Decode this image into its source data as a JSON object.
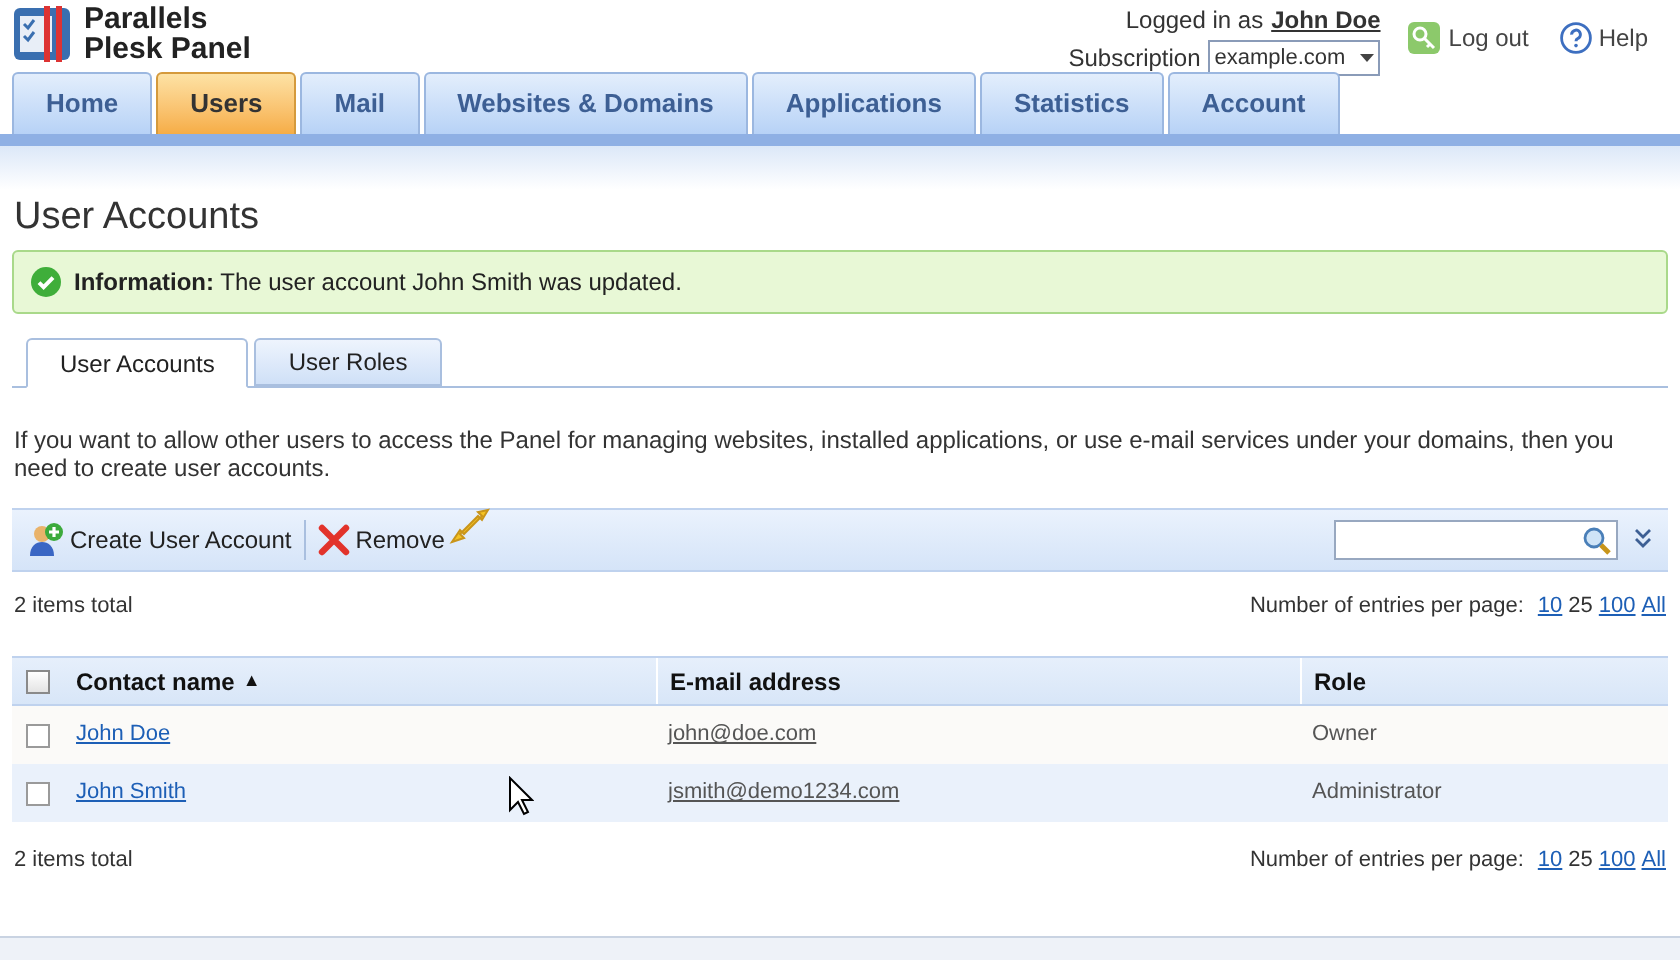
{
  "brand": {
    "line_1": "Parallels",
    "line_2": "Plesk Panel"
  },
  "header": {
    "logged_in_label": "Logged in as",
    "user": "John Doe",
    "subscription_label": "Subscription",
    "subscription": "example.com",
    "logout": "Log out",
    "help": "Help"
  },
  "nav_tabs": [
    {
      "label": "Home",
      "selected": false
    },
    {
      "label": "Users",
      "selected": true
    },
    {
      "label": "Mail",
      "selected": false
    },
    {
      "label": "Websites & Domains",
      "selected": false
    },
    {
      "label": "Applications",
      "selected": false
    },
    {
      "label": "Statistics",
      "selected": false
    },
    {
      "label": "Account",
      "selected": false
    }
  ],
  "page_title": "User Accounts",
  "message": {
    "text": "**Information:** The user account John Smith was updated."
  },
  "sub_tabs": [
    {
      "label": "User Accounts",
      "selected": true
    },
    {
      "label": "User Roles",
      "selected": false
    }
  ],
  "description": "If you want to allow other users to access the Panel for managing websites, installed applications, or use e-mail services under your domains, then you need to create user accounts.",
  "toolbar": {
    "buttons": [
      {
        "label": "Create User Account",
        "kind": "create"
      },
      {
        "label": "Remove",
        "kind": "remove"
      }
    ]
  },
  "summary_top": {
    "total": "2 items total",
    "per_page_label": "Number of entries per page:",
    "options": [
      {
        "label": "10",
        "selected": false
      },
      {
        "label": "25",
        "selected": true
      },
      {
        "label": "100",
        "selected": false
      },
      {
        "label": "All",
        "selected": false
      }
    ]
  },
  "table": {
    "select_all_checked": false,
    "columns": [
      {
        "label": "Contact name",
        "sort": "▲"
      },
      {
        "label": "E-mail address"
      },
      {
        "label": "Role"
      }
    ],
    "rows": [
      {
        "name": "John Doe",
        "email": "john@doe.com",
        "role": "Owner",
        "checked": false
      },
      {
        "name": "John Smith",
        "email": "jsmith@demo1234.com",
        "role": "Administrator",
        "checked": false
      }
    ]
  },
  "summary_bottom": {
    "total": "2 items total",
    "per_page_label": "Number of entries per page:",
    "options": [
      {
        "label": "10",
        "selected": false
      },
      {
        "label": "25",
        "selected": true
      },
      {
        "label": "100",
        "selected": false
      },
      {
        "label": "All",
        "selected": false
      }
    ]
  }
}
